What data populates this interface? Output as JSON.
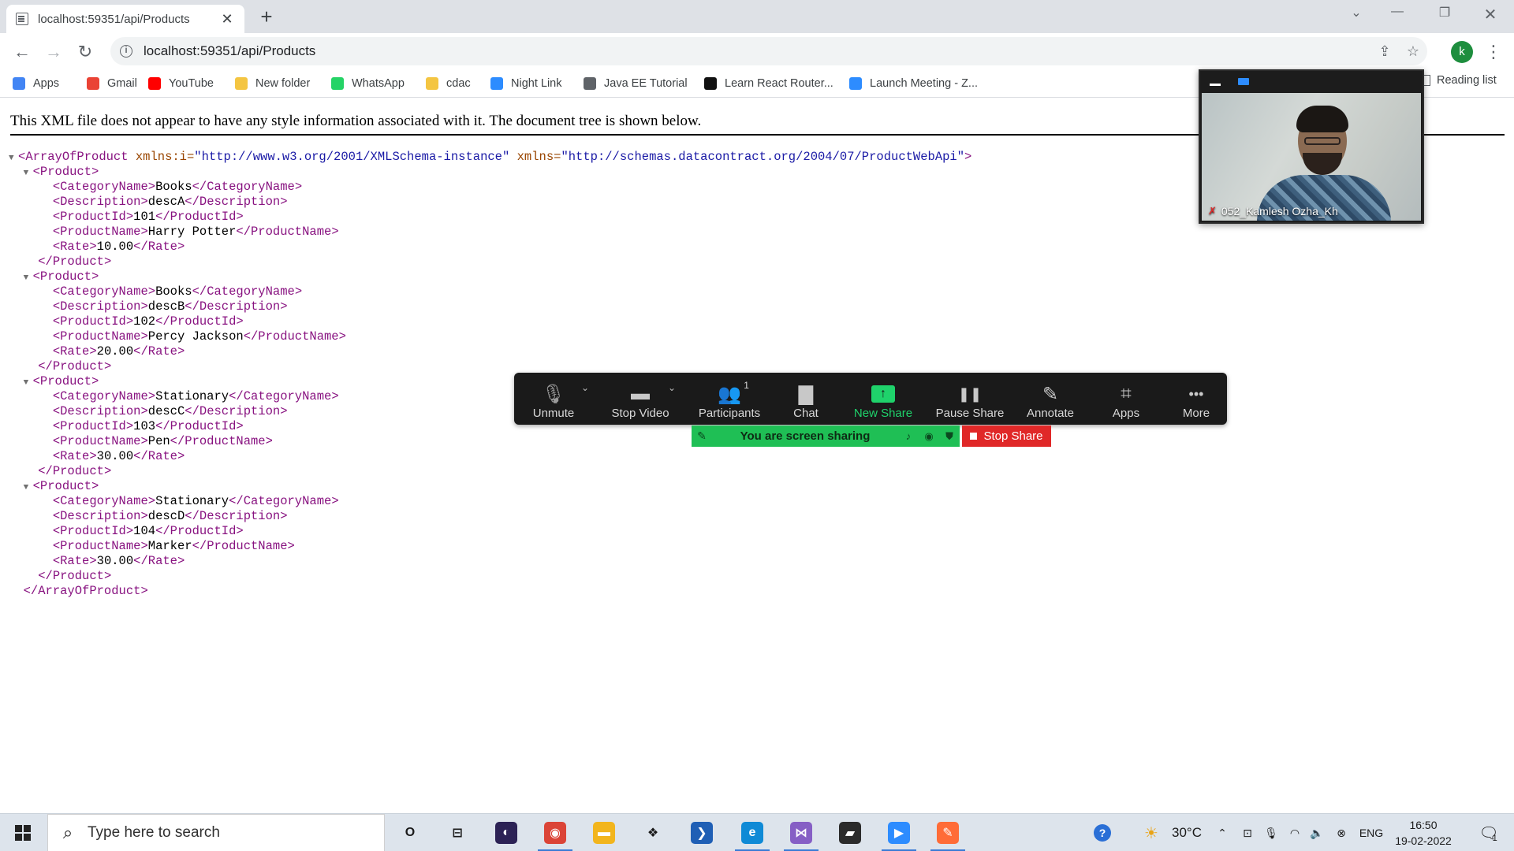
{
  "browser": {
    "tab_title": "localhost:59351/api/Products",
    "tab_close": "✕",
    "new_tab": "+",
    "url": "localhost:59351/api/Products",
    "profile_initial": "k",
    "bookmarks": [
      {
        "label": "Apps",
        "icon": "apps-grid-icon",
        "color": "#4285f4"
      },
      {
        "label": "Gmail",
        "icon": "gmail-icon",
        "color": "#ea4335"
      },
      {
        "label": "YouTube",
        "icon": "youtube-icon",
        "color": "#ff0000"
      },
      {
        "label": "New folder",
        "icon": "folder-icon",
        "color": "#f4c542"
      },
      {
        "label": "WhatsApp",
        "icon": "whatsapp-icon",
        "color": "#25d366"
      },
      {
        "label": "cdac",
        "icon": "folder-icon",
        "color": "#f4c542"
      },
      {
        "label": "Night Link",
        "icon": "zoom-icon",
        "color": "#2d8cff"
      },
      {
        "label": "Java EE Tutorial",
        "icon": "globe-icon",
        "color": "#5f6368"
      },
      {
        "label": "Learn React Router...",
        "icon": "react-router-icon",
        "color": "#111111"
      },
      {
        "label": "Launch Meeting - Z...",
        "icon": "zoom-icon",
        "color": "#2d8cff"
      }
    ],
    "reading_list": "Reading list"
  },
  "page": {
    "notice": "This XML file does not appear to have any style information associated with it. The document tree is shown below.",
    "root_tag": "ArrayOfProduct",
    "root_attrs": [
      {
        "name": "xmlns:i",
        "value": "http://www.w3.org/2001/XMLSchema-instance"
      },
      {
        "name": "xmlns",
        "value": "http://schemas.datacontract.org/2004/07/ProductWebApi"
      }
    ],
    "item_tag": "Product",
    "field_tags": [
      "CategoryName",
      "Description",
      "ProductId",
      "ProductName",
      "Rate"
    ],
    "products": [
      {
        "CategoryName": "Books",
        "Description": "descA",
        "ProductId": "101",
        "ProductName": "Harry Potter",
        "Rate": "10.00"
      },
      {
        "CategoryName": "Books",
        "Description": "descB",
        "ProductId": "102",
        "ProductName": "Percy Jackson",
        "Rate": "20.00"
      },
      {
        "CategoryName": "Stationary",
        "Description": "descC",
        "ProductId": "103",
        "ProductName": "Pen",
        "Rate": "30.00"
      },
      {
        "CategoryName": "Stationary",
        "Description": "descD",
        "ProductId": "104",
        "ProductName": "Marker",
        "Rate": "30.00"
      }
    ]
  },
  "zoom": {
    "participant_name": "052_Kamlesh Ozha_Kh",
    "controls": [
      {
        "label": "Unmute",
        "icon": "muted-mic-icon",
        "caret": true
      },
      {
        "label": "Stop Video",
        "icon": "video-camera-icon",
        "caret": true
      },
      {
        "label": "Participants",
        "icon": "participants-icon",
        "count": "1"
      },
      {
        "label": "Chat",
        "icon": "chat-icon"
      },
      {
        "label": "New Share",
        "icon": "share-screen-icon",
        "green": true
      },
      {
        "label": "Pause Share",
        "icon": "pause-icon"
      },
      {
        "label": "Annotate",
        "icon": "pencil-icon"
      },
      {
        "label": "Apps",
        "icon": "apps-icon"
      },
      {
        "label": "More",
        "icon": "more-dots-icon"
      }
    ],
    "sharing_status": "You are screen sharing",
    "stop_share": "Stop Share"
  },
  "taskbar": {
    "search_placeholder": "Type here to search",
    "apps": [
      {
        "name": "task-view",
        "glyph": "O",
        "color": "transparent"
      },
      {
        "name": "task-switch",
        "glyph": "⊟",
        "color": "transparent"
      },
      {
        "name": "eclipse",
        "glyph": "◐",
        "color": "#2c2255"
      },
      {
        "name": "chrome",
        "glyph": "◉",
        "color": "#db4437",
        "active": true
      },
      {
        "name": "file-explorer",
        "glyph": "▬",
        "color": "#f2b51d"
      },
      {
        "name": "dropbox",
        "glyph": "❖",
        "color": "transparent"
      },
      {
        "name": "powershell",
        "glyph": "❯",
        "color": "#1f5fb5"
      },
      {
        "name": "edge",
        "glyph": "e",
        "color": "#0f8ad6",
        "active": true
      },
      {
        "name": "visual-studio",
        "glyph": "⋈",
        "color": "#865fc5",
        "active": true
      },
      {
        "name": "sticky-notes",
        "glyph": "▰",
        "color": "#2b2b2b"
      },
      {
        "name": "zoom",
        "glyph": "▶",
        "color": "#2d8cff",
        "active": true
      },
      {
        "name": "postman",
        "glyph": "✎",
        "color": "#ff6c37",
        "active": true
      }
    ],
    "weather": "30°C",
    "language": "ENG",
    "time": "16:50",
    "date": "19-02-2022",
    "notification_count": "1"
  }
}
